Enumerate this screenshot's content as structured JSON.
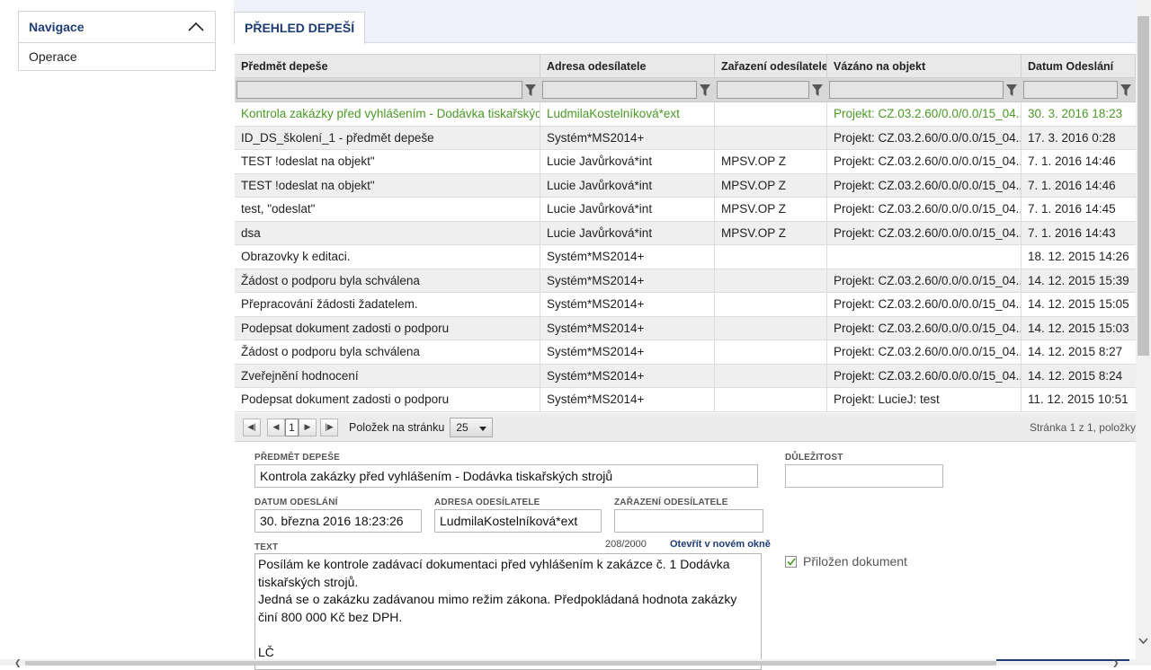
{
  "nav": {
    "title": "Navigace",
    "items": [
      "Operace"
    ]
  },
  "tab": {
    "label": "PŘEHLED DEPEŠÍ"
  },
  "grid": {
    "columns": [
      "Předmět depeše",
      "Adresa odesílatele",
      "Zařazení odesílatele",
      "Vázáno na objekt",
      "Datum Odeslání"
    ],
    "rows": [
      [
        "Kontrola zakázky před vyhlášením - Dodávka tiskařských...",
        "LudmilaKostelníková*ext",
        "",
        "Projekt: CZ.03.2.60/0.0/0.0/15_04...",
        "30. 3. 2016 18:23"
      ],
      [
        "ID_DS_školení_1 - předmět depeše",
        "Systém*MS2014+",
        "",
        "Projekt: CZ.03.2.60/0.0/0.0/15_04...",
        "17. 3. 2016 0:28"
      ],
      [
        "TEST !odeslat na objekt\"",
        "Lucie Javůrková*int",
        "MPSV.OP Z",
        "Projekt: CZ.03.2.60/0.0/0.0/15_04...",
        "7. 1. 2016 14:46"
      ],
      [
        "TEST !odeslat na objekt\"",
        "Lucie Javůrková*int",
        "MPSV.OP Z",
        "Projekt: CZ.03.2.60/0.0/0.0/15_04...",
        "7. 1. 2016 14:46"
      ],
      [
        "test, \"odeslat\"",
        "Lucie Javůrková*int",
        "MPSV.OP Z",
        "Projekt: CZ.03.2.60/0.0/0.0/15_04...",
        "7. 1. 2016 14:45"
      ],
      [
        "dsa",
        "Lucie Javůrková*int",
        "MPSV.OP Z",
        "Projekt: CZ.03.2.60/0.0/0.0/15_04...",
        "7. 1. 2016 14:43"
      ],
      [
        "Obrazovky k editaci.",
        "Systém*MS2014+",
        "",
        "",
        "18. 12. 2015 14:26"
      ],
      [
        "Žádost o podporu byla schválena",
        "Systém*MS2014+",
        "",
        "Projekt: CZ.03.2.60/0.0/0.0/15_04...",
        "14. 12. 2015 15:39"
      ],
      [
        "Přepracování žádosti žadatelem.",
        "Systém*MS2014+",
        "",
        "Projekt: CZ.03.2.60/0.0/0.0/15_04...",
        "14. 12. 2015 15:05"
      ],
      [
        "Podepsat dokument zadosti o podporu",
        "Systém*MS2014+",
        "",
        "Projekt: CZ.03.2.60/0.0/0.0/15_04...",
        "14. 12. 2015 15:03"
      ],
      [
        "Žádost o podporu byla schválena",
        "Systém*MS2014+",
        "",
        "Projekt: CZ.03.2.60/0.0/0.0/15_04...",
        "14. 12. 2015 8:27"
      ],
      [
        "Zveřejnění hodnocení",
        "Systém*MS2014+",
        "",
        "Projekt: CZ.03.2.60/0.0/0.0/15_04...",
        "14. 12. 2015 8:24"
      ],
      [
        "Podepsat dokument zadosti o podporu",
        "Systém*MS2014+",
        "",
        "Projekt: LucieJ: test",
        "11. 12. 2015 10:51"
      ]
    ],
    "selected_row": 0
  },
  "pager": {
    "page": "1",
    "page_size_label": "Položek na stránku",
    "page_size": "25",
    "info": "Stránka 1 z 1, položky"
  },
  "detail": {
    "subject_label": "PŘEDMĚT DEPEŠE",
    "subject_value": "Kontrola zakázky před vyhlášením -  Dodávka tiskařských strojů",
    "importance_label": "DŮLEŽITOST",
    "importance_value": "",
    "date_label": "DATUM ODESLÁNÍ",
    "date_value": "30. března 2016 18:23:26",
    "address_label": "ADRESA ODESÍLATELE",
    "address_value": "LudmilaKostelníková*ext",
    "category_label": "ZAŘAZENÍ ODESÍLATELE",
    "category_value": "",
    "text_label": "TEXT",
    "counter": "208/2000",
    "open_link": "Otevřít v novém okně",
    "text_lines": [
      "Posílám ke kontrole zadávací dokumentaci před vyhlášením k zakázce č. 1 Dodávka tiskařských strojů.",
      "Jedná se o zakázku zadávanou mimo režim zákona. Předpokládaná hodnota zakázky činí 800 000 Kč bez DPH.",
      "",
      "LČ"
    ],
    "attached_label": "Přiložen dokument",
    "attached_checked": true
  },
  "colors": {
    "accent": "#1f3c75",
    "selected_row_text": "#4a9a24",
    "tab_bar": "#eef1fa"
  }
}
